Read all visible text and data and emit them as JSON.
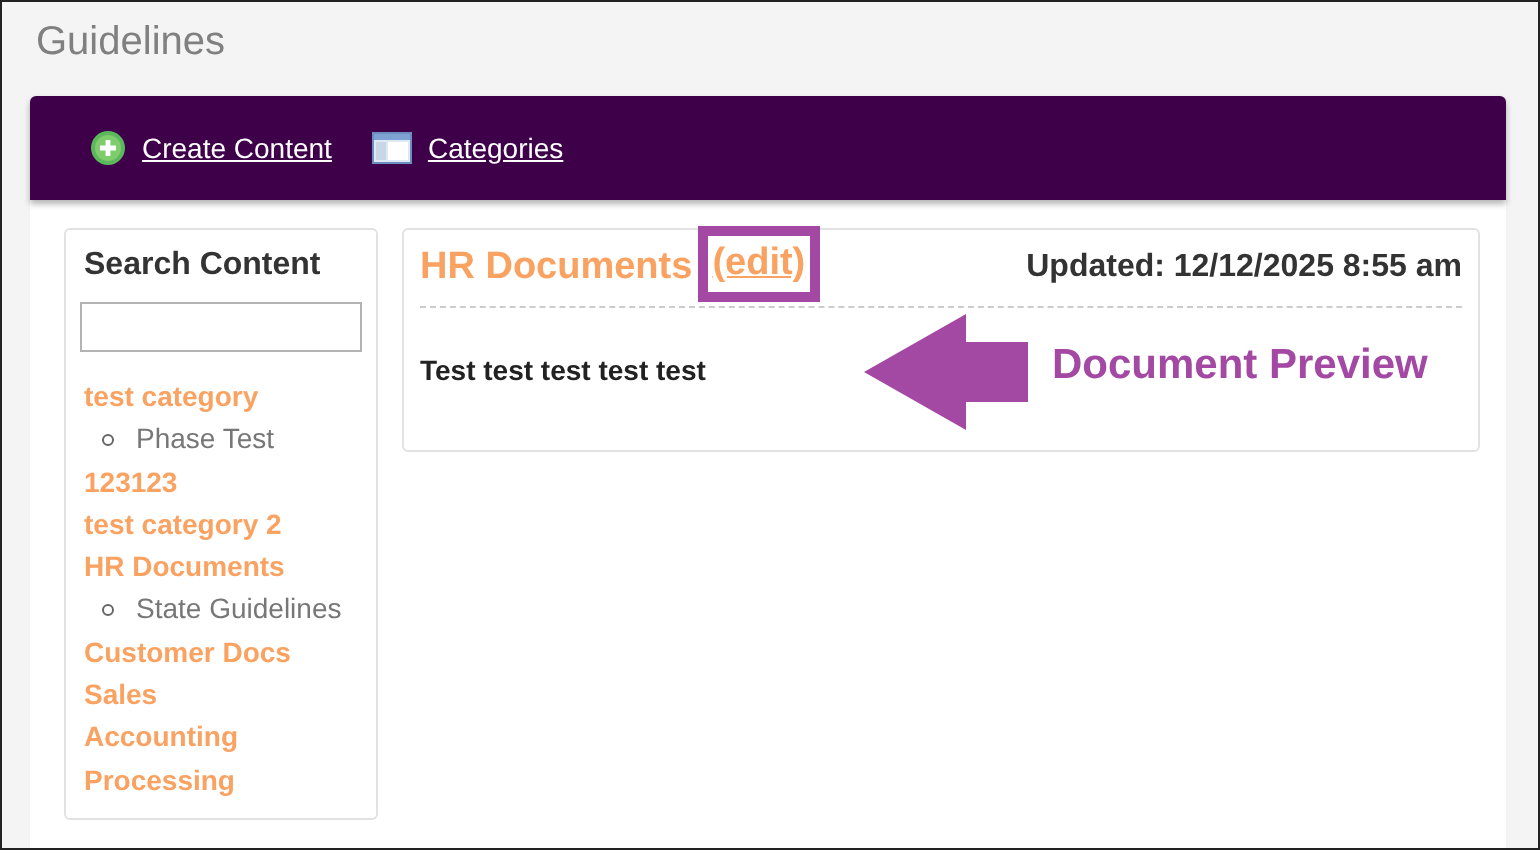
{
  "page_title": "Guidelines",
  "toolbar": [
    {
      "label": "Create Content",
      "kind": "add"
    },
    {
      "label": "Categories",
      "kind": "list"
    }
  ],
  "sidebar": {
    "heading": "Search Content",
    "categories": [
      {
        "label": "test category",
        "children": [
          {
            "label": "Phase Test"
          }
        ]
      },
      {
        "label": "123123"
      },
      {
        "label": "test category 2"
      },
      {
        "label": "HR Documents",
        "children": [
          {
            "label": "State Guidelines"
          }
        ]
      },
      {
        "label": "Customer Docs"
      },
      {
        "label": "Sales"
      },
      {
        "label": "Accounting"
      },
      {
        "label": "Processing"
      }
    ]
  },
  "document": {
    "title": "HR Documents",
    "edit_link": "(edit)",
    "updated": "Updated: 12/12/2025 8:55 am",
    "body": "Test test test test test"
  },
  "annotation": {
    "label": "Document Preview"
  }
}
